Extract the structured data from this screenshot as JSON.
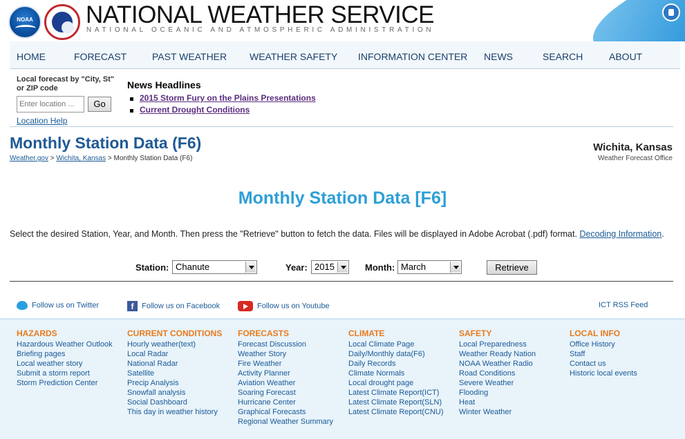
{
  "header": {
    "title": "NATIONAL WEATHER SERVICE",
    "subtitle": "NATIONAL OCEANIC AND ATMOSPHERIC ADMINISTRATION",
    "noaa_logo_text": "NOAA"
  },
  "nav": {
    "items": [
      "HOME",
      "FORECAST",
      "PAST WEATHER",
      "WEATHER SAFETY",
      "INFORMATION CENTER",
      "NEWS",
      "SEARCH",
      "ABOUT"
    ]
  },
  "local_forecast": {
    "label": "Local forecast by \"City, St\" or ZIP code",
    "placeholder": "Enter location ...",
    "go_label": "Go",
    "help_label": "Location Help"
  },
  "news": {
    "title": "News Headlines",
    "items": [
      "2015 Storm Fury on the Plains Presentations",
      "Current Drought Conditions"
    ]
  },
  "page": {
    "title": "Monthly Station Data (F6)",
    "breadcrumb": [
      "Weather.gov",
      "Wichita, Kansas",
      "Monthly Station Data (F6)"
    ],
    "breadcrumb_sep": ">",
    "office_name": "Wichita, Kansas",
    "office_sub": "Weather Forecast Office",
    "heading": "Monthly Station Data [F6]",
    "instructions": "Select the desired Station, Year, and Month. Then press the \"Retrieve\" button to fetch the data.  Files will be displayed in Adobe Acrobat (.pdf) format.",
    "decoding_link": "Decoding Information",
    "period": "."
  },
  "form": {
    "station_label": "Station:",
    "station_value": "Chanute",
    "year_label": "Year:",
    "year_value": "2015",
    "month_label": "Month:",
    "month_value": "March",
    "retrieve_label": "Retrieve"
  },
  "social": {
    "twitter": "Follow us on Twitter",
    "facebook": "Follow us on Facebook",
    "youtube": "Follow us on Youtube",
    "rss": "ICT RSS Feed"
  },
  "footer": {
    "columns": [
      {
        "title": "HAZARDS",
        "links": [
          "Hazardous Weather Outlook",
          "Briefing pages",
          "Local weather story",
          "Submit a storm report",
          "Storm Prediction Center"
        ]
      },
      {
        "title": "CURRENT CONDITIONS",
        "links": [
          "Hourly weather(text)",
          "Local Radar",
          "National Radar",
          "Satellite",
          "Precip Analysis",
          "Snowfall analysis",
          "Social Dashboard",
          "This day in weather history"
        ]
      },
      {
        "title": "FORECASTS",
        "links": [
          "Forecast Discussion",
          "Weather Story",
          "Fire Weather",
          "Activity Planner",
          "Aviation Weather",
          "Soaring Forecast",
          "Hurricane Center",
          "Graphical Forecasts",
          "Regional Weather Summary"
        ]
      },
      {
        "title": "CLIMATE",
        "links": [
          "Local Climate Page",
          "Daily/Monthly data(F6)",
          "Daily Records",
          "Climate Normals",
          "Local drought page",
          "Latest Climate Report(ICT)",
          "Latest Climate Report(SLN)",
          "Latest Climate Report(CNU)"
        ]
      },
      {
        "title": "SAFETY",
        "links": [
          "Local Preparedness",
          "Weather Ready Nation",
          "NOAA Weather Radio",
          "Road Conditions",
          "Severe Weather",
          "Flooding",
          "Heat",
          "Winter Weather"
        ]
      },
      {
        "title": "LOCAL INFO",
        "links": [
          "Office History",
          "Staff",
          "Contact us",
          "Historic local events"
        ]
      }
    ]
  },
  "colors": {
    "brand_blue": "#1f5a94",
    "heading_blue": "#2e9fd6",
    "footer_orange": "#e87b1e",
    "link_blue": "#1a5a96",
    "visited_purple": "#5c2d80"
  }
}
